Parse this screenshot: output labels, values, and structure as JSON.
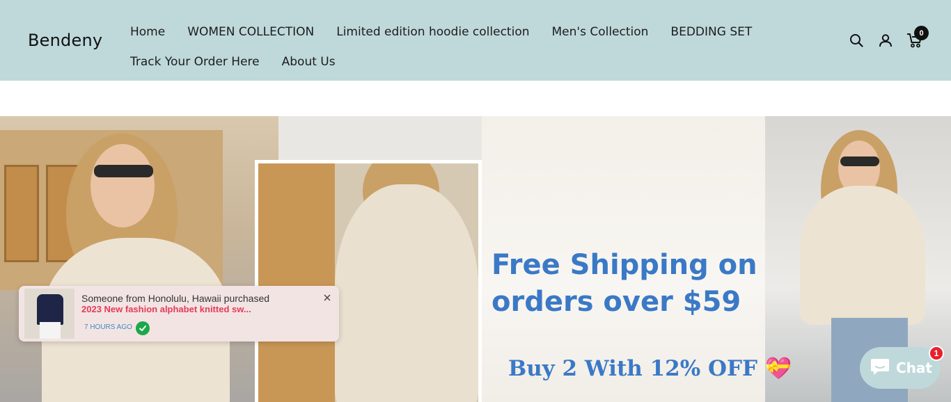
{
  "header": {
    "logo": "Bendeny",
    "nav_row1": [
      "Home",
      "WOMEN COLLECTION",
      "Limited edition hoodie collection",
      "Men's Collection",
      "BEDDING SET"
    ],
    "nav_row2": [
      "Track Your Order Here",
      "About Us"
    ],
    "cart_count": "0",
    "icons": [
      "search-icon",
      "account-icon",
      "cart-icon"
    ]
  },
  "hero": {
    "promo_line1": "Free Shipping on",
    "promo_line2": "orders over $59",
    "promo_line3": "Buy 2 With 12% OFF",
    "promo_heart": "💝",
    "colors": {
      "promo_text": "#3a79c6",
      "header_bg": "#bfd9db"
    }
  },
  "toast": {
    "message": "Someone from Honolulu, Hawaii purchased",
    "product": "2023 New fashion alphabet knitted sw...",
    "time": "7 HOURS AGO"
  },
  "chat": {
    "label": "Chat",
    "badge": "1"
  }
}
